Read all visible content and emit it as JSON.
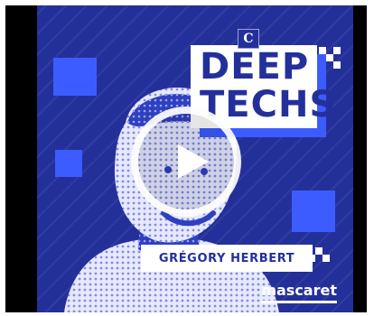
{
  "player": {
    "poster": {
      "logo_mark": "C",
      "title_line1": "DEEP",
      "title_line2": "TECHS",
      "guest_name": "GRÉGORY HERBERT",
      "brand": "mascaret"
    },
    "controls": {
      "play_icon": "play-icon"
    },
    "colors": {
      "background": "#24309a",
      "accent": "#3d5cff",
      "white": "#ffffff",
      "frame": "#000000"
    }
  }
}
